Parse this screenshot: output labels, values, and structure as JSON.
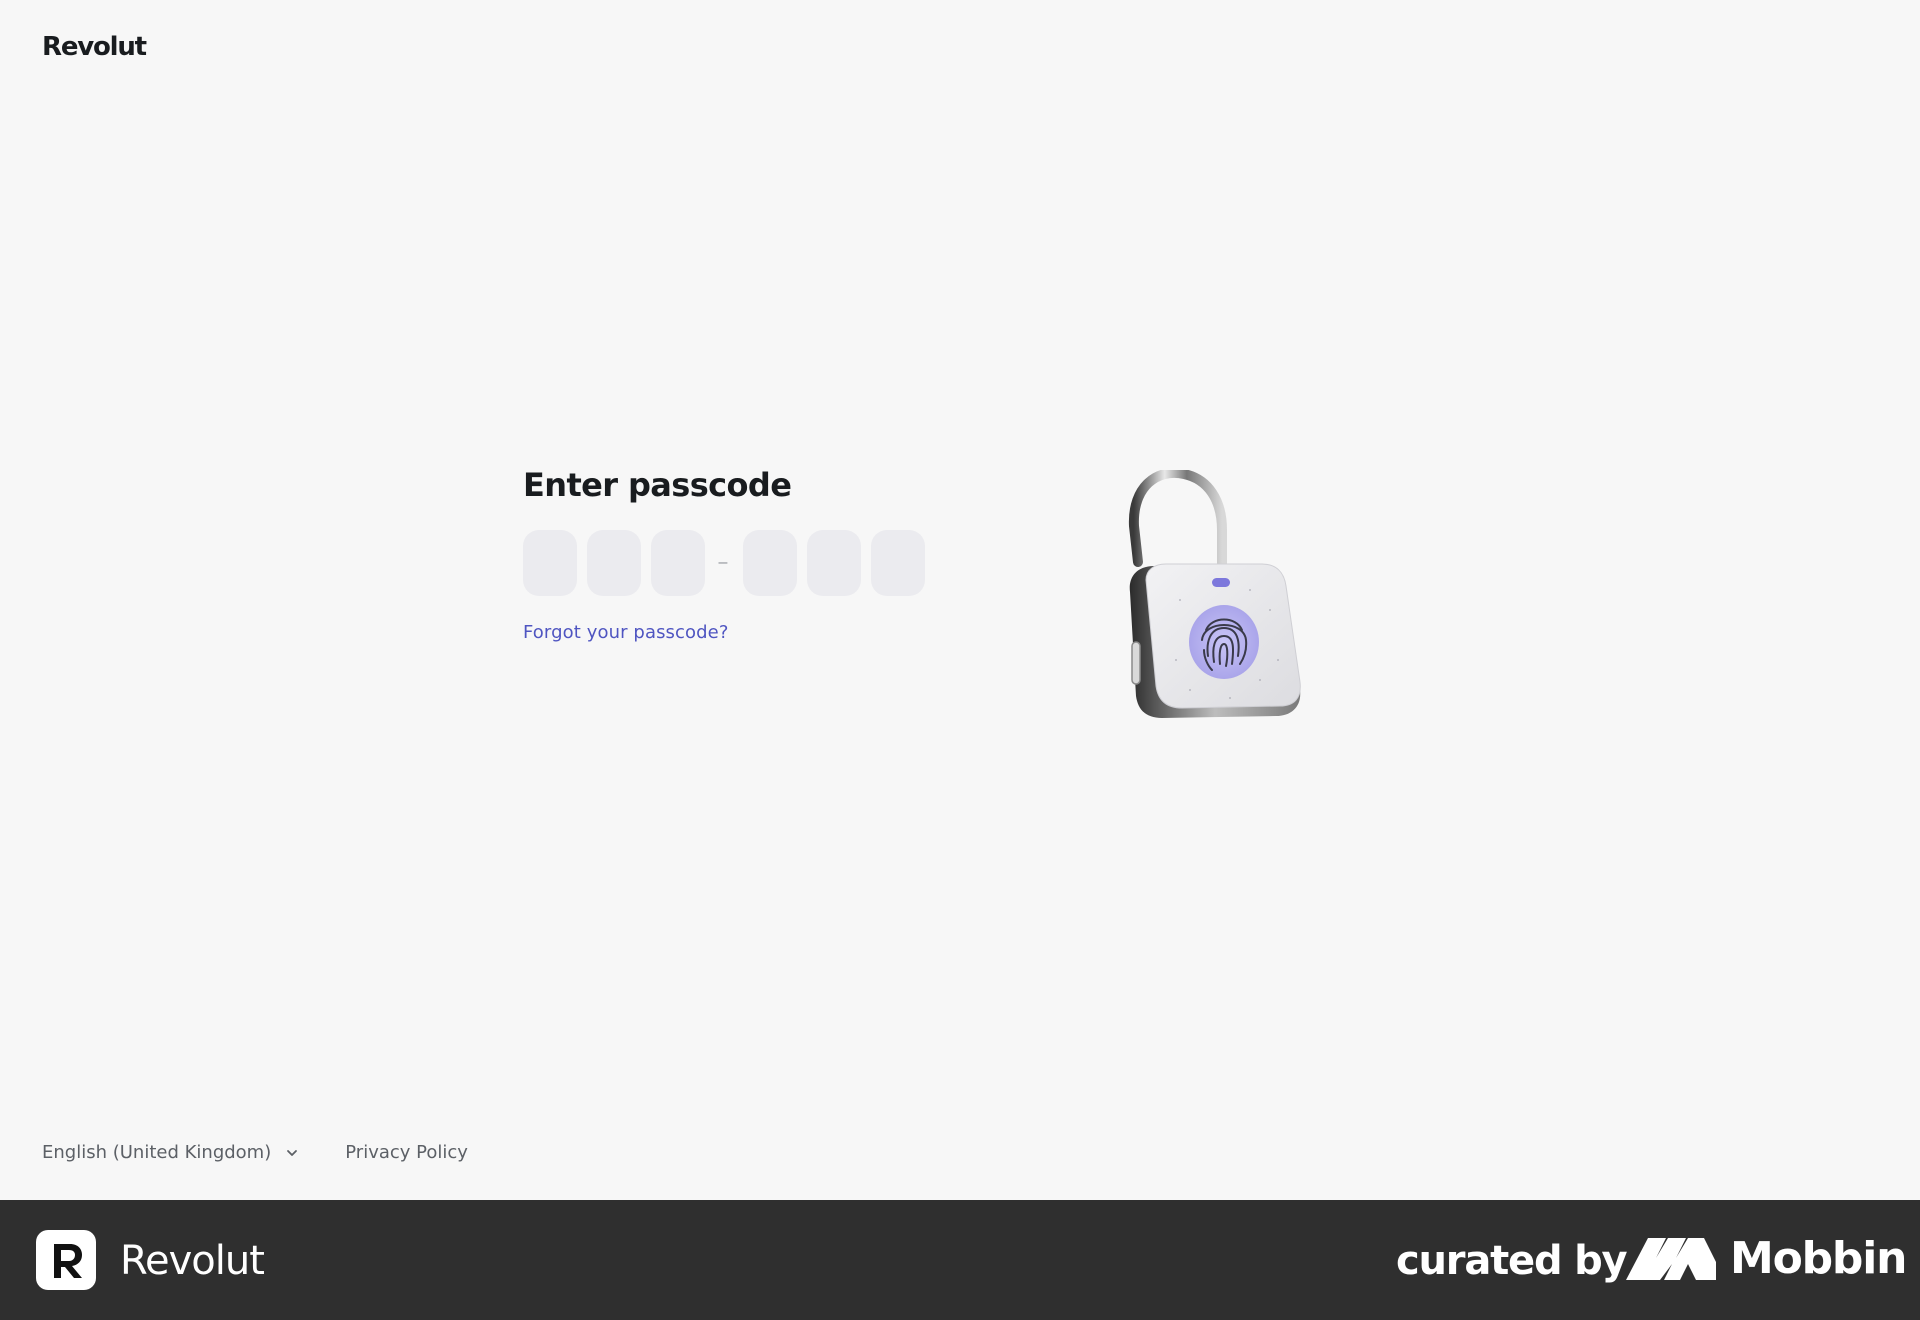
{
  "header": {
    "logo_text": "Revolut"
  },
  "main": {
    "title": "Enter passcode",
    "passcode": {
      "digits": [
        "",
        "",
        "",
        "",
        "",
        ""
      ],
      "separator": "–"
    },
    "forgot_link": "Forgot your passcode?",
    "illustration_icon": "fingerprint-padlock-icon"
  },
  "footer": {
    "language": "English (United Kingdom)",
    "privacy": "Privacy Policy"
  },
  "banner": {
    "app_name": "Revolut",
    "curated_by": "curated by",
    "brand": "Mobbin"
  },
  "colors": {
    "background": "#f7f7f7",
    "input_bg": "#ebebef",
    "link": "#4f55c1",
    "banner_bg": "#2f2f2f",
    "fingerprint_accent": "#b7b3ef"
  }
}
